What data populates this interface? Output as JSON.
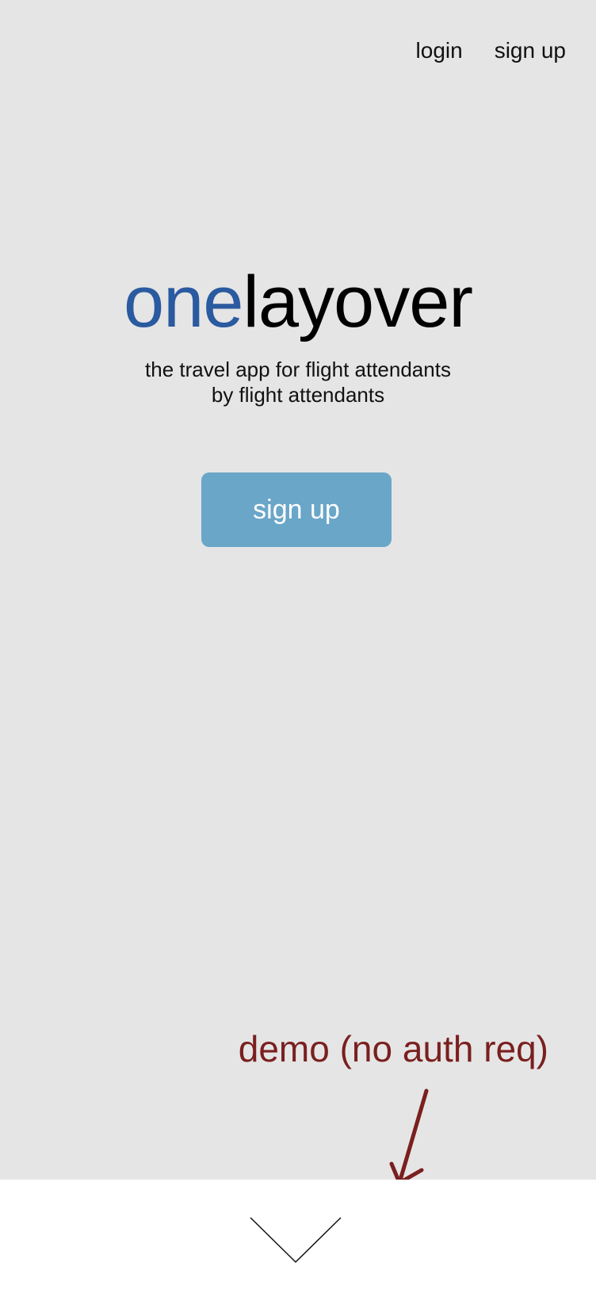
{
  "nav": {
    "login_label": "login",
    "signup_label": "sign up"
  },
  "brand": {
    "accent": "one",
    "main": "layover",
    "accent_color": "#2a5aa0"
  },
  "tagline": {
    "line1": "the travel app for flight attendants",
    "line2": "by flight attendants"
  },
  "cta": {
    "label": "sign up",
    "color": "#6aa6c8"
  },
  "annotation": {
    "text": "demo (no auth req)",
    "color": "#7a1f1f"
  },
  "footer": {
    "icon": "chevron-down-icon"
  }
}
